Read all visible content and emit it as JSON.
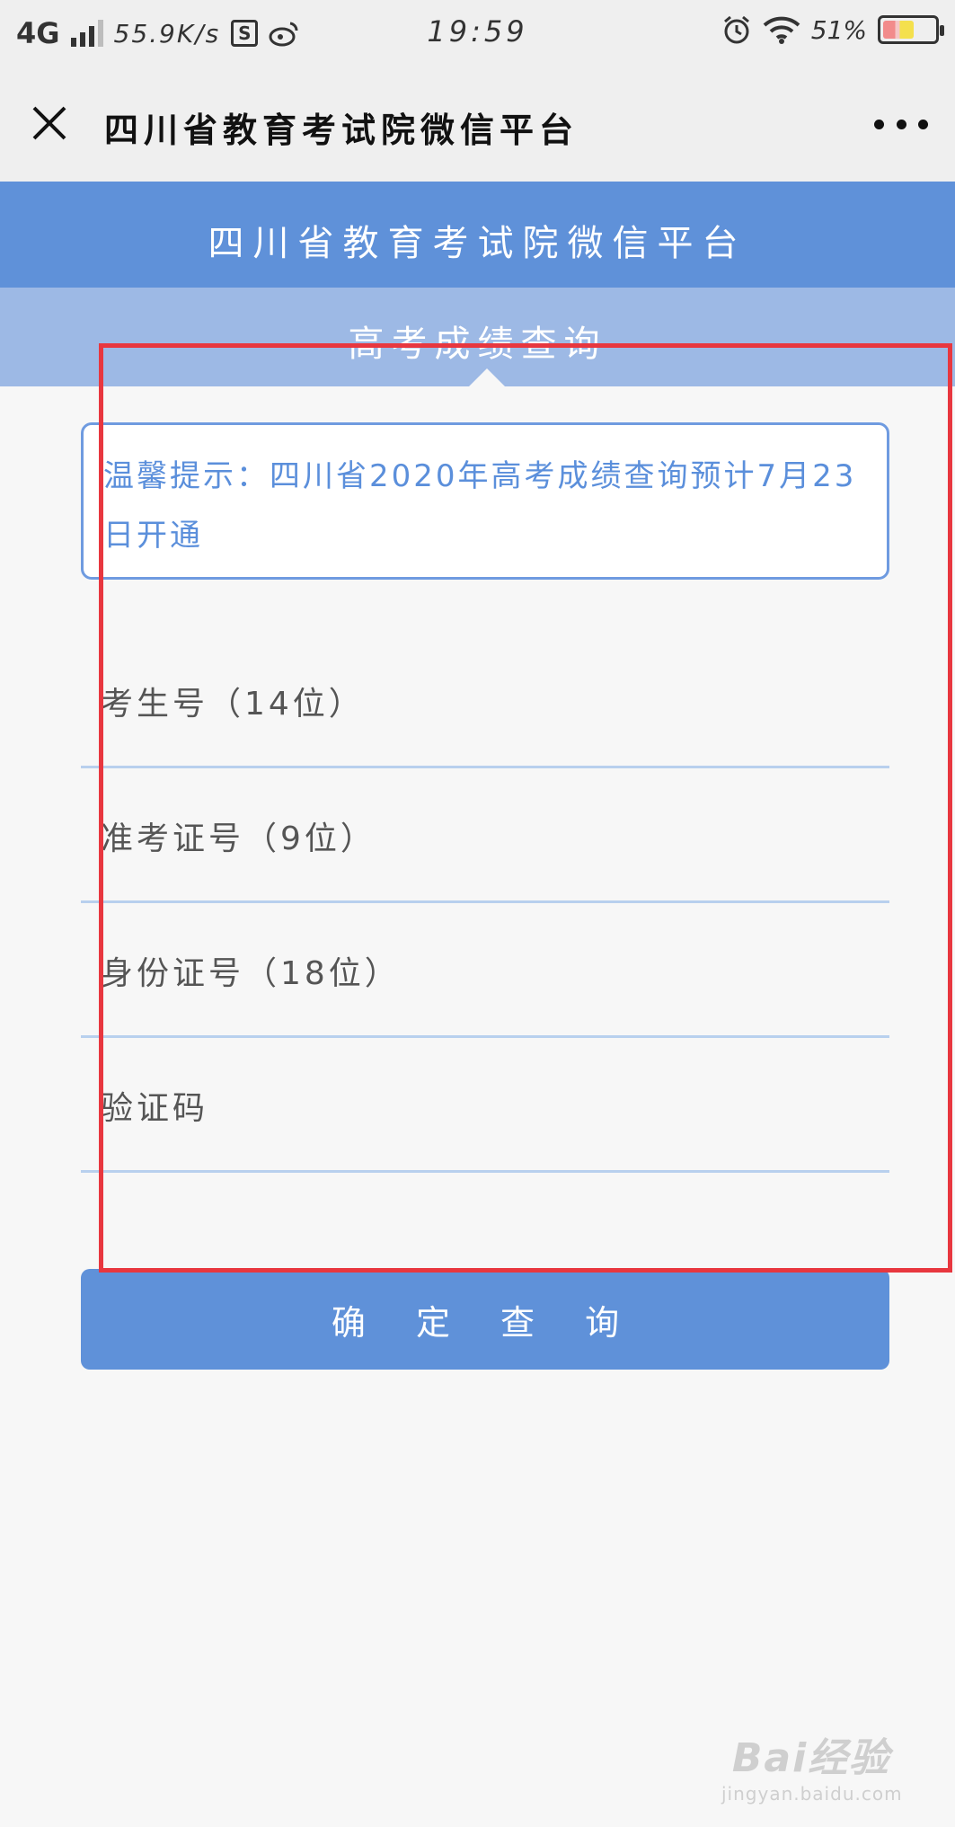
{
  "status_bar": {
    "network": "4G",
    "speed": "55.9K/s",
    "time": "19:59",
    "battery": "51%"
  },
  "title_bar": {
    "title": "四川省教育考试院微信平台"
  },
  "header": {
    "title": "四川省教育考试院微信平台"
  },
  "tab": {
    "label": "高考成绩查询"
  },
  "notice": {
    "text": "温馨提示：四川省2020年高考成绩查询预计7月23日开通"
  },
  "form": {
    "exam_number_placeholder": "考生号（14位）",
    "admission_ticket_placeholder": "准考证号（9位）",
    "id_number_placeholder": "身份证号（18位）",
    "captcha_placeholder": "验证码",
    "submit_label": "确 定 查 询"
  },
  "watermark": {
    "logo": "Bai经验",
    "url": "jingyan.baidu.com"
  },
  "colors": {
    "primary": "#5f91d9",
    "tab_band": "#9db9e5",
    "notice_text": "#5b8fdb",
    "annotation": "#e8373f"
  }
}
